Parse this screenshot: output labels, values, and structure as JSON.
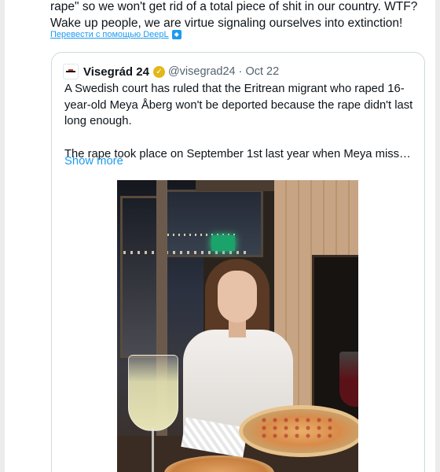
{
  "tweet": {
    "text_tail": "rape\" so we won't get rid of a total piece of shit in our country. WTF? Wake up people, we are virtue signaling ourselves into extinction!",
    "translate_link": "Перевести с помощью DeepL",
    "translate_icon": "deepl-icon"
  },
  "quote": {
    "display_name": "Visegrád 24",
    "handle": "@visegrad24",
    "separator": "·",
    "date": "Oct 22",
    "verified_icon": "verified-badge-icon",
    "paragraph1": "A Swedish court has ruled that the Eritrean migrant who raped 16-year-old Meya Åberg won't be deported because the rape didn't last long enough.",
    "paragraph2": "The rape took place on September 1st last year when Meya missed her...",
    "show_more": "Show more"
  },
  "colors": {
    "link": "#1d9bf0",
    "text": "#0f1419",
    "muted": "#536471",
    "border": "#cfd9de",
    "verified": "#e2b719"
  }
}
